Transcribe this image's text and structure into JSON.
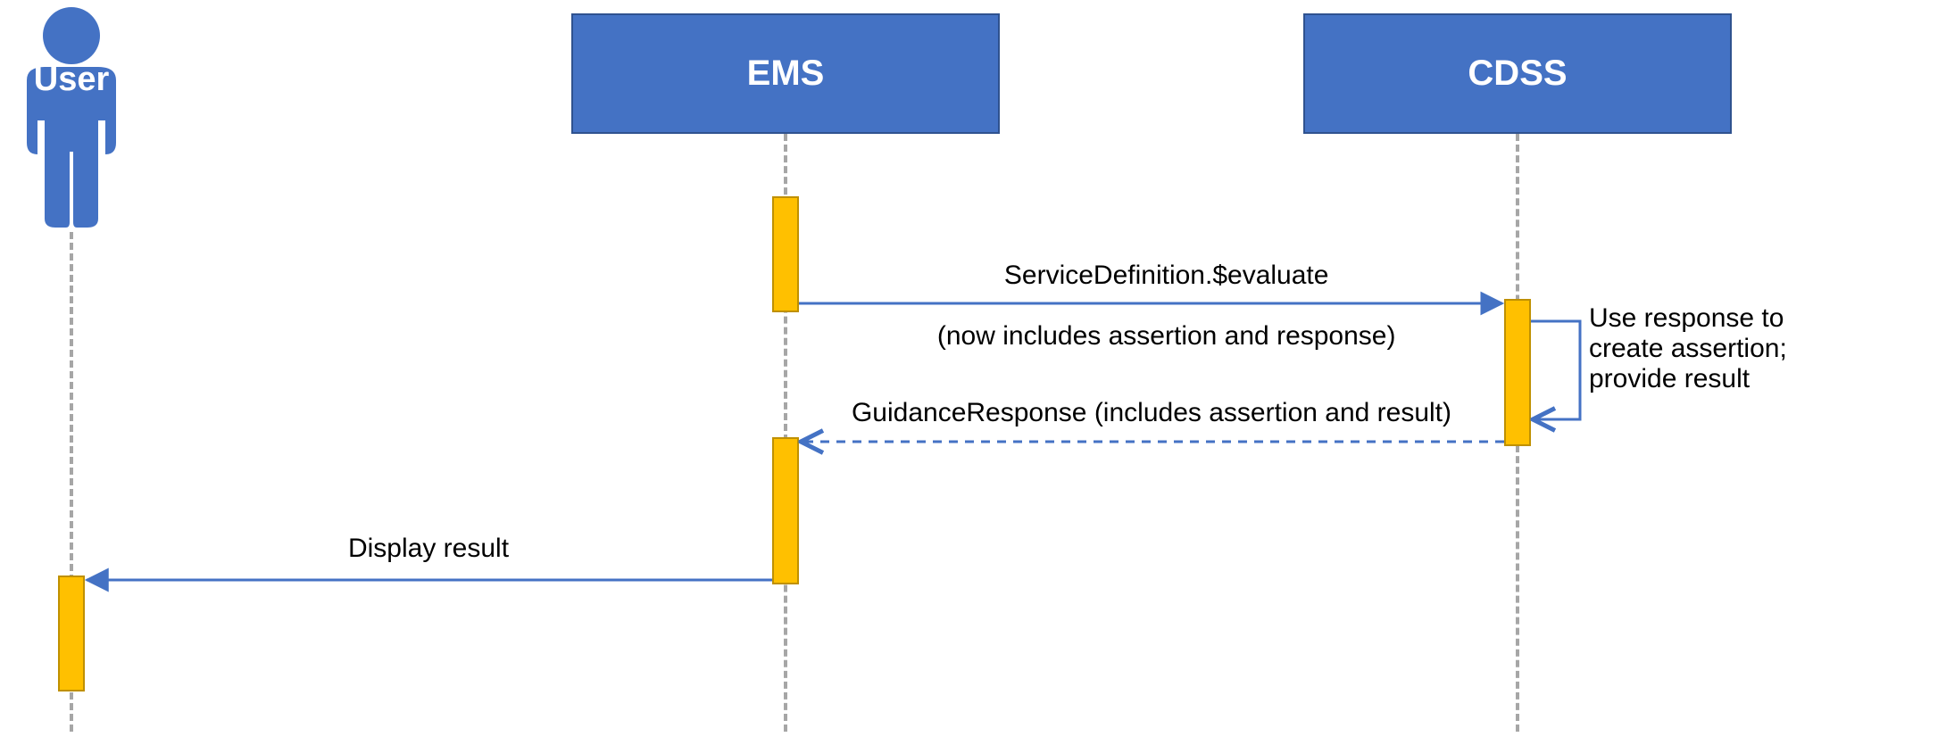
{
  "participants": {
    "user": {
      "label": "User"
    },
    "ems": {
      "label": "EMS"
    },
    "cdss": {
      "label": "CDSS"
    }
  },
  "messages": {
    "m1": {
      "label_line1": "ServiceDefinition.$evaluate",
      "label_line2": "(now includes assertion and response)"
    },
    "m2": {
      "label": "GuidanceResponse (includes assertion and result)"
    },
    "m3": {
      "label": "Display result"
    },
    "self1": {
      "label": "Use response to\ncreate assertion;\nprovide result"
    }
  },
  "colors": {
    "participant_fill": "#4472C4",
    "participant_border": "#2F528F",
    "activation_fill": "#FFC000",
    "activation_border": "#BF9000",
    "line": "#4472C4",
    "lifeline": "#A6A6A6"
  }
}
